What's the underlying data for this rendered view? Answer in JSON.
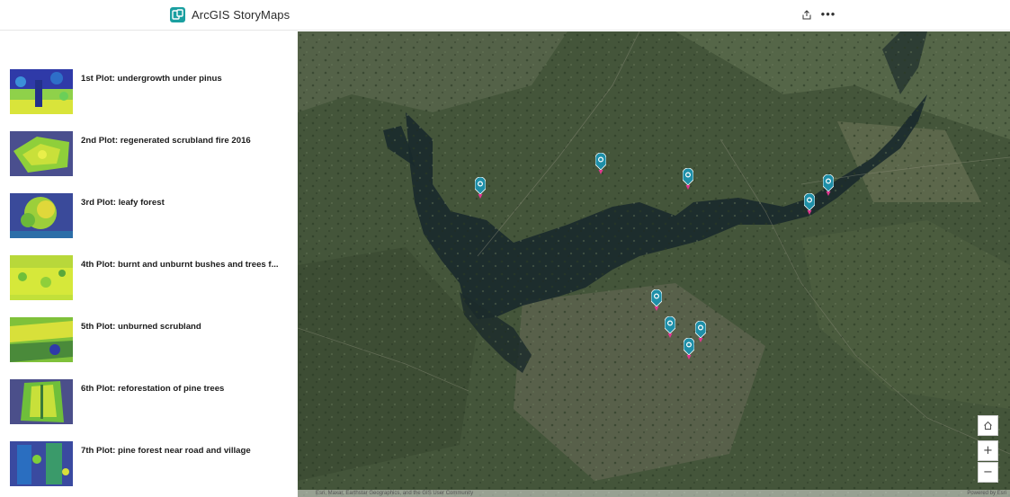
{
  "header": {
    "brand_name": "ArcGIS StoryMaps",
    "share_icon": "share-icon",
    "more_icon": "more-options-icon",
    "more_glyph": "•••",
    "accent_color": "#1a9fa0"
  },
  "sidebar": {
    "items": [
      {
        "label": "1st Plot: undergrowth under pinus"
      },
      {
        "label": "2nd Plot: regenerated scrubland fire 2016"
      },
      {
        "label": "3rd Plot: leafy forest"
      },
      {
        "label": "4th Plot: burnt and unburnt bushes and trees f..."
      },
      {
        "label": "5th Plot: unburned scrubland"
      },
      {
        "label": "6th Plot: reforestation of pine trees"
      },
      {
        "label": "7th Plot: pine forest near road and village"
      }
    ]
  },
  "map": {
    "pin_color": "#1e8fa8",
    "pin_tip_color": "#e0388f",
    "controls": {
      "home_icon": "home-icon",
      "zoom_in_glyph": "+",
      "zoom_out_glyph": "−"
    },
    "attribution": "Esri, Maxar, Earthstar Geographics, and the GIS User Community",
    "powered_by": "Powered by Esri"
  }
}
